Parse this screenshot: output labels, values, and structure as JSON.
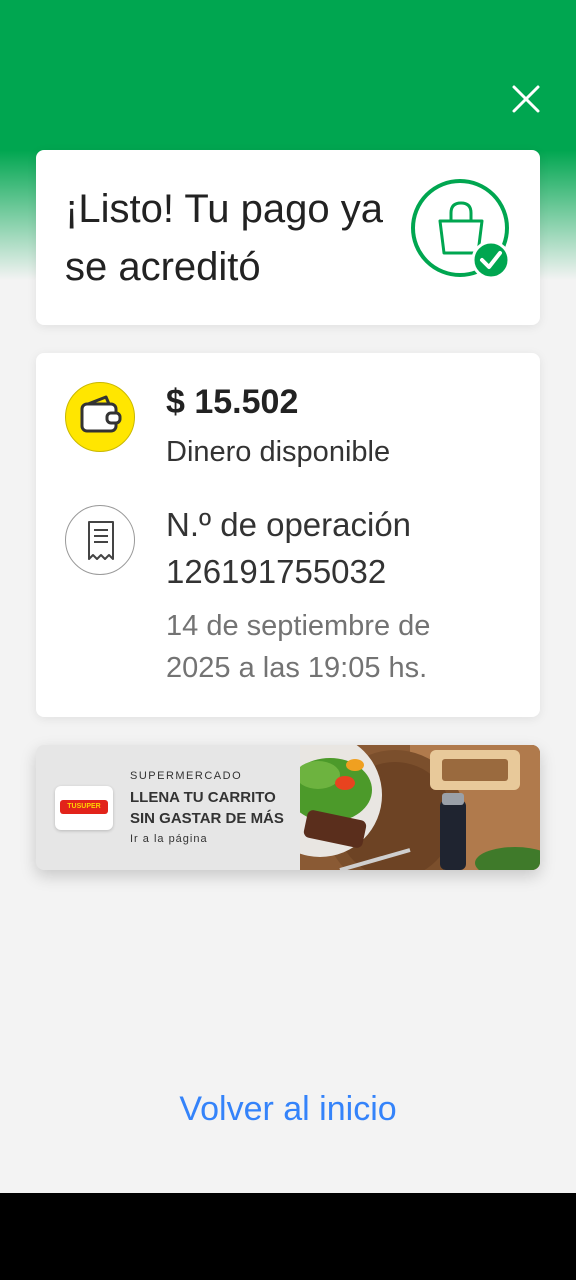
{
  "header": {
    "title": "¡Listo! Tu pago ya se acreditó",
    "close_icon": "close-icon",
    "status_icon": "shopping-bag-check-icon",
    "accent_color": "#00a650"
  },
  "balance": {
    "amount": "$ 15.502",
    "label": "Dinero disponible",
    "icon": "wallet-icon"
  },
  "operation": {
    "label": "N.º de operación",
    "number": "126191755032",
    "date": "14 de septiembre de 2025 a las 19:05 hs.",
    "icon": "receipt-icon"
  },
  "banner": {
    "kicker": "SUPERMERCADO",
    "headline": "LLENA TU CARRITO SIN GASTAR DE MÁS",
    "link": "Ir a la página",
    "logo_text": "TUSUPER"
  },
  "footer": {
    "back_link": "Volver al inicio",
    "link_color": "#3483fa"
  }
}
